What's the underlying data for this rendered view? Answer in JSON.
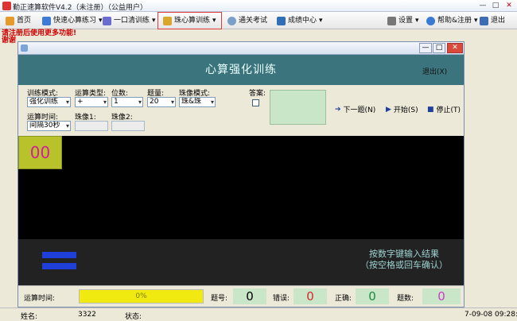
{
  "app": {
    "title": "勤正速算软件V4.2（未注册）（公益用户）",
    "controls": {
      "minimize": "—",
      "maximize": "□",
      "close": "✕"
    }
  },
  "toolbar": {
    "home": "首页",
    "quick": "快速心算练习",
    "oneshot": "一口清训练",
    "abacus": "珠心算训练",
    "exam": "通关考试",
    "scores": "成绩中心",
    "settings": "设置",
    "help": "帮助&注册",
    "exit": "退出"
  },
  "notice": {
    "line1": "请注册后使用更多功能!",
    "line2": "谢谢"
  },
  "dialog": {
    "controls": {
      "minimize": "—",
      "maximize": "□",
      "close": "✕"
    },
    "title": "心算强化训练",
    "exit": "退出(X)",
    "labels": {
      "mode": "训练模式:",
      "optype": "运算类型:",
      "digits": "位数:",
      "count": "题量:",
      "abacus_mode": "珠像模式:",
      "answer": "答案:",
      "time": "运算时间:",
      "img1": "珠像1:",
      "img2": "珠像2:"
    },
    "values": {
      "mode": "强化训练",
      "optype": "+",
      "digits": "1",
      "count": "20",
      "abacus_mode": "珠&珠",
      "time": "间隔30秒"
    },
    "actions": {
      "next": "下一题(N)",
      "start": "开始(S)",
      "stop": "停止(T)"
    },
    "display": {
      "number": "00"
    },
    "hint": {
      "line1": "按数字键输入结果",
      "line2": "（按空格或回车确认）"
    },
    "status": {
      "time_label": "运算时间:",
      "progress_text": "0%",
      "progress": 0,
      "qno_label": "题号:",
      "qno": "0",
      "wrong_label": "错误:",
      "wrong": "0",
      "right_label": "正确:",
      "right": "0",
      "total_label": "题数:",
      "total": "0"
    }
  },
  "footer": {
    "name_label": "姓名:",
    "name_value": "3322",
    "state_label": "状态:",
    "datetime": "7-09-08 09:28:02",
    "left_partial": "姓名"
  },
  "colors": {
    "header": "#3b747c",
    "tile": "#b8c22a",
    "progress": "#f0ea11",
    "value_bg": "#c9e6c9",
    "bars": "#1e3fd8"
  }
}
